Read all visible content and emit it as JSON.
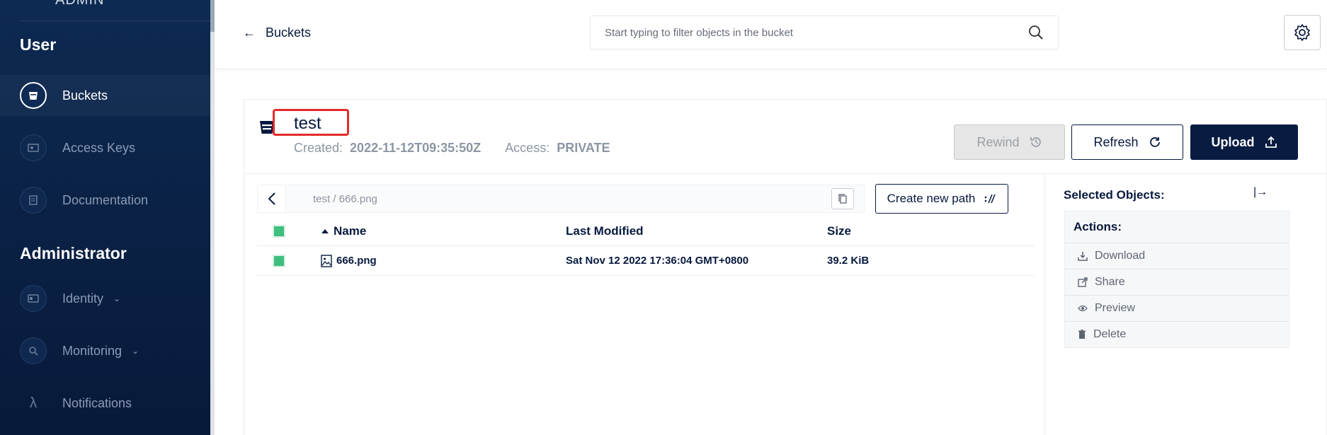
{
  "sidebar": {
    "brand": "ADMIN",
    "user_section": "User",
    "admin_section": "Administrator",
    "user_items": [
      {
        "label": "Buckets",
        "icon": "bucket-icon",
        "active": true
      },
      {
        "label": "Access Keys",
        "icon": "key-card-icon"
      },
      {
        "label": "Documentation",
        "icon": "document-icon"
      }
    ],
    "admin_items": [
      {
        "label": "Identity",
        "icon": "id-card-icon",
        "chevron": "⌄"
      },
      {
        "label": "Monitoring",
        "icon": "magnifier-icon",
        "chevron": "⌄"
      },
      {
        "label": "Notifications",
        "icon": "lambda-icon"
      }
    ]
  },
  "header": {
    "back_label": "Buckets",
    "back_arrow": "←",
    "search_placeholder": "Start typing to filter objects in the bucket"
  },
  "bucket": {
    "name": "test",
    "created_label": "Created:",
    "created_value": "2022-11-12T09:35:50Z",
    "access_label": "Access:",
    "access_value": "PRIVATE"
  },
  "toolbar": {
    "rewind": "Rewind",
    "refresh": "Refresh",
    "upload": "Upload",
    "create_path": "Create new path"
  },
  "breadcrumb": {
    "path": "test  /  666.png"
  },
  "table": {
    "columns": {
      "name": "Name",
      "modified": "Last Modified",
      "size": "Size"
    },
    "rows": [
      {
        "name": "666.png",
        "modified": "Sat Nov 12 2022 17:36:04 GMT+0800",
        "size": "39.2 KiB"
      }
    ]
  },
  "panel": {
    "title": "Selected Objects:",
    "actions_title": "Actions:",
    "actions": [
      "Download",
      "Share",
      "Preview",
      "Delete"
    ]
  },
  "colors": {
    "sidebar_bg": "#0a2145",
    "primary": "#081c42",
    "checkbox": "#3fbf7f",
    "highlight": "#e32b2b"
  }
}
